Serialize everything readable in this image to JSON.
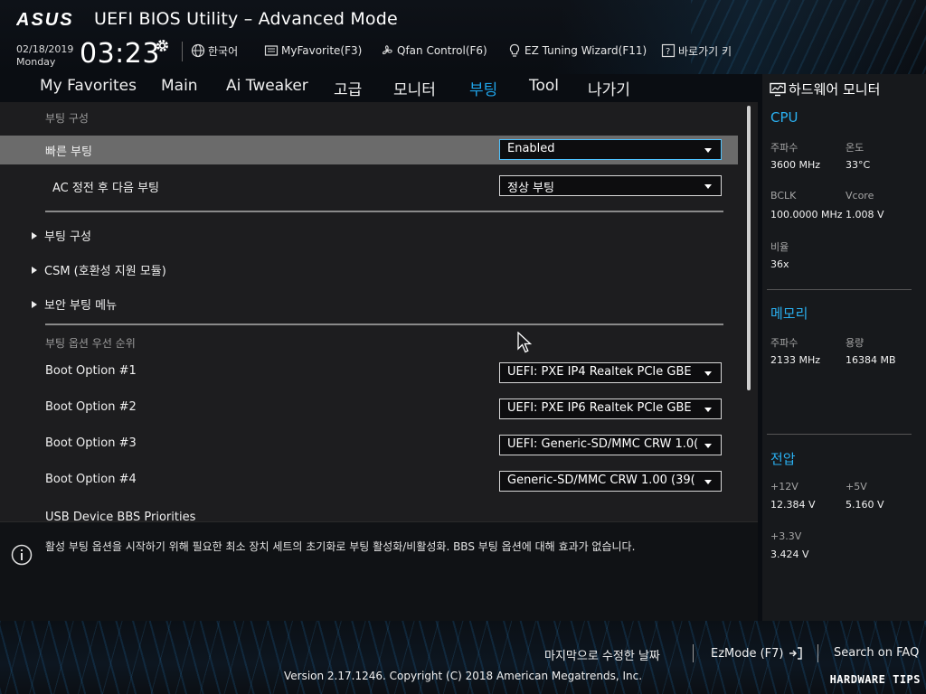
{
  "header": {
    "brand": "ASUS",
    "title": "UEFI BIOS Utility – Advanced Mode",
    "date": "02/18/2019",
    "weekday": "Monday",
    "time": "03:23",
    "buttons": [
      {
        "label": "한국어",
        "icon": "globe-icon"
      },
      {
        "label": "MyFavorite(F3)",
        "icon": "favorite-icon"
      },
      {
        "label": "Qfan Control(F6)",
        "icon": "fan-icon"
      },
      {
        "label": "EZ Tuning Wizard(F11)",
        "icon": "bulb-icon"
      },
      {
        "label": "바로가기 키",
        "icon": "hotkey-icon"
      }
    ]
  },
  "tabs": [
    {
      "label": "My Favorites"
    },
    {
      "label": "Main"
    },
    {
      "label": "Ai Tweaker"
    },
    {
      "label": "고급"
    },
    {
      "label": "모니터"
    },
    {
      "label": "부팅",
      "active": true
    },
    {
      "label": "Tool"
    },
    {
      "label": "나가기"
    }
  ],
  "main": {
    "section1_title": "부팅 구성",
    "fast_boot": {
      "label": "빠른 부팅",
      "value": "Enabled"
    },
    "ac_power": {
      "label": "AC 정전 후 다음 부팅",
      "value": "정상 부팅"
    },
    "submenus": [
      "부팅 구성",
      "CSM (호환성 지원 모듈)",
      "보안 부팅 메뉴"
    ],
    "section2_title": "부팅 옵션 우선 순위",
    "boot_options": [
      {
        "label": "Boot Option #1",
        "value": "UEFI: PXE IP4 Realtek PCIe GBE"
      },
      {
        "label": "Boot Option #2",
        "value": "UEFI: PXE IP6 Realtek PCIe GBE"
      },
      {
        "label": "Boot Option #3",
        "value": "UEFI: Generic-SD/MMC CRW 1.0("
      },
      {
        "label": "Boot Option #4",
        "value": "Generic-SD/MMC CRW 1.00  (39("
      }
    ],
    "truncated_item": "USB Device BBS Priorities"
  },
  "help": {
    "text": "활성 부팅 옵션을 시작하기 위해 필요한 최소 장치 세트의 초기화로 부팅 활성화/비활성화. BBS 부팅 옵션에 대해 효과가 없습니다."
  },
  "monitor": {
    "title": "하드웨어 모니터",
    "cpu": {
      "title": "CPU",
      "freq_label": "주파수",
      "freq": "3600 MHz",
      "temp_label": "온도",
      "temp": "33°C",
      "bclk_label": "BCLK",
      "bclk": "100.0000 MHz",
      "vcore_label": "Vcore",
      "vcore": "1.008 V",
      "ratio_label": "비율",
      "ratio": "36x"
    },
    "memory": {
      "title": "메모리",
      "freq_label": "주파수",
      "freq": "2133 MHz",
      "cap_label": "용량",
      "cap": "16384 MB"
    },
    "voltage": {
      "title": "전압",
      "v12_label": "+12V",
      "v12": "12.384 V",
      "v5_label": "+5V",
      "v5": "5.160 V",
      "v33_label": "+3.3V",
      "v33": "3.424 V"
    }
  },
  "footer": {
    "last_modified": "마지막으로 수정한 날짜",
    "ezmode": "EzMode (F7)",
    "search": "Search on FAQ",
    "copyright": "Version 2.17.1246. Copyright (C) 2018 American Megatrends, Inc.",
    "watermark": "HARDWARE TIPS"
  },
  "colors": {
    "accent": "#1fa3e8",
    "selected_row": "#6b6b6b",
    "panel": "#1d1d1f",
    "monitor_bg": "#17191c"
  }
}
